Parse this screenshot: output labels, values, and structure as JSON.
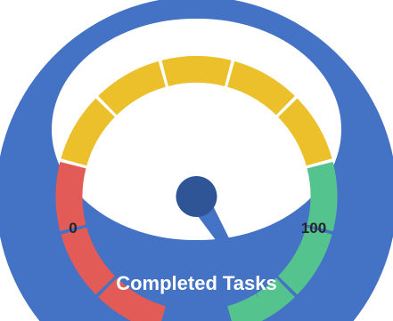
{
  "chart_data": {
    "type": "gauge",
    "title": "Completed Tasks",
    "min": 0,
    "max": 100,
    "value": 95,
    "min_label": "0",
    "max_label": "100",
    "segment_colors": [
      "#e35b56",
      "#e35b56",
      "#e35b56",
      "#ecc02a",
      "#ecc02a",
      "#ecc02a",
      "#ecc02a",
      "#ecc02a",
      "#55c38e",
      "#55c38e",
      "#55c38e"
    ]
  },
  "colors": {
    "frame": "#4472c4",
    "needle": "#4472c4",
    "hub": "#2f5597",
    "face": "#ffffff",
    "label_text": "#262626",
    "title_text": "#ffffff"
  }
}
